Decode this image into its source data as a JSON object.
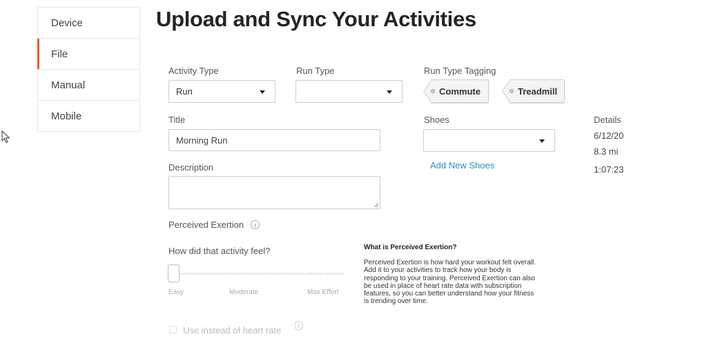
{
  "sidebar": {
    "items": [
      {
        "label": "Device",
        "active": false
      },
      {
        "label": "File",
        "active": true
      },
      {
        "label": "Manual",
        "active": false
      },
      {
        "label": "Mobile",
        "active": false
      }
    ]
  },
  "page_title": "Upload and Sync Your Activities",
  "form": {
    "activity_type": {
      "label": "Activity Type",
      "value": "Run"
    },
    "run_type": {
      "label": "Run Type",
      "value": ""
    },
    "run_type_tagging": {
      "label": "Run Type Tagging",
      "tags": [
        "Commute",
        "Treadmill"
      ]
    },
    "title": {
      "label": "Title",
      "value": "Morning Run"
    },
    "shoes": {
      "label": "Shoes",
      "value": "",
      "add_link": "Add New Shoes"
    },
    "description": {
      "label": "Description",
      "value": ""
    },
    "perceived_exertion": {
      "label": "Perceived Exertion",
      "question": "How did that activity feel?",
      "scale": {
        "min": "Easy",
        "mid": "Moderate",
        "max": "Max Effort"
      },
      "value": 0,
      "use_instead_label": "Use instead of heart rate",
      "use_instead_checked": false
    }
  },
  "details": {
    "label": "Details",
    "date": "6/12/20",
    "distance": "8.3 mi",
    "duration": "1:07:23"
  },
  "pe_help": {
    "title": "What is Perceived Exertion?",
    "body": "Perceived Exertion is how hard your workout felt overall. Add it to your activities to track how your body is responding to your training. Perceived Exertion can also be used in place of heart rate data with subscription features, so you can better understand how your fitness is trending over time."
  },
  "colors": {
    "accent": "#f15a24",
    "link": "#2f8cc0"
  }
}
